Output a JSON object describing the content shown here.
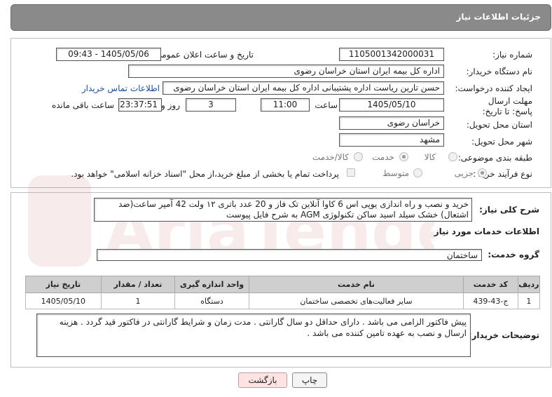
{
  "header": {
    "title": "جزئیات اطلاعات نیاز"
  },
  "fields": {
    "need_number": {
      "label": "شماره نیاز:",
      "value": "1105001342000031"
    },
    "announce_datetime": {
      "label": "تاریخ و ساعت اعلان عمومی:",
      "value": "1405/05/06 - 09:43"
    },
    "buyer_org": {
      "label": "نام دستگاه خریدار:",
      "value": "اداره کل بیمه ایران استان خراسان رضوی"
    },
    "requester": {
      "label": "ایجاد کننده درخواست:",
      "value": "حسن تارین ریاست اداره پشتیبانی اداره کل بیمه ایران استان خراسان رضوی"
    },
    "buyer_contact_link": "اطلاعات تماس خریدار",
    "deadline": {
      "label": "مهلت ارسال پاسخ: تا تاریخ:",
      "date": "1405/05/10",
      "time_label": "ساعت",
      "time": "11:00",
      "days": "3",
      "days_label": "روز و",
      "remaining": "23:37:51",
      "remaining_label": "ساعت باقی مانده"
    },
    "province": {
      "label": "استان محل تحویل:",
      "value": "خراسان رضوی"
    },
    "city": {
      "label": "شهر محل تحویل:",
      "value": "مشهد"
    },
    "category": {
      "label": "طبقه بندی موضوعی:",
      "options": [
        "کالا",
        "خدمت",
        "کالا/خدمت"
      ],
      "selected": "خدمت"
    },
    "process": {
      "label": "نوع فرآیند خرید :",
      "options": [
        "جزیی",
        "متوسط"
      ],
      "selected": "جزیی",
      "note": "پرداخت تمام یا بخشی از مبلغ خرید،از محل \"اسناد خزانه اسلامی\" خواهد بود."
    }
  },
  "description": {
    "label": "شرح کلی نیاز:",
    "text": "خرید و نصب و راه اندازی یوپی اس 6 کاوا آنلاین تک فاز  و 20 عدد باتری ۱۲ ولت 42 آمپر ساعت(ضد اشتعال) خشک سیلد اسید ساکن تکنولوژی AGM به شرح فایل پیوست"
  },
  "services": {
    "title": "اطلاعات خدمات مورد نیاز",
    "group_label": "گروه خدمت:",
    "group_value": "ساختمان",
    "table": {
      "headers": [
        "ردیف",
        "کد خدمت",
        "نام خدمت",
        "واحد اندازه گیری",
        "تعداد / مقدار",
        "تاریخ نیاز"
      ],
      "rows": [
        [
          "1",
          "ج-43-439",
          "سایر فعالیت‌های تخصصی ساختمان",
          "دستگاه",
          "1",
          "1405/05/10"
        ]
      ]
    }
  },
  "buyer_notes": {
    "label": "توضیحات خریدار:",
    "text": "پیش فاکتور الزامی می باشد . دارای حداقل دو سال گارانتی . مدت زمان و شرایط گارانتی در فاکتور قید گردد . هزینه ارسال و نصب به عهده تامین کننده می باشد ."
  },
  "buttons": {
    "print": "چاپ",
    "back": "بازگشت"
  },
  "watermark": "AriaTender.net"
}
